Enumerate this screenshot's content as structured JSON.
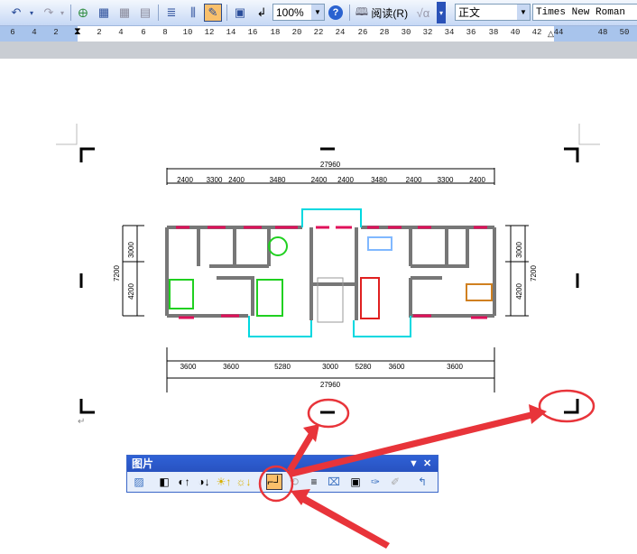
{
  "toolbar": {
    "zoom": "100%",
    "read_label": "阅读(R)",
    "style": "正文",
    "font": "Times New Roman"
  },
  "ruler": {
    "ticks": [
      "6",
      "4",
      "2",
      "2",
      "4",
      "6",
      "8",
      "10",
      "12",
      "14",
      "16",
      "18",
      "20",
      "22",
      "24",
      "26",
      "28",
      "30",
      "32",
      "34",
      "36",
      "38",
      "40",
      "42",
      "44",
      "48",
      "50"
    ]
  },
  "drawing": {
    "top_total": "27960",
    "top_dims": [
      "2400",
      "3300",
      "2400",
      "3480",
      "2400",
      "2400",
      "3480",
      "2400",
      "3300",
      "2400"
    ],
    "bottom_dims": [
      "3600",
      "3600",
      "5280",
      "3000",
      "5280",
      "3600",
      "3600"
    ],
    "bottom_total": "27960",
    "left_dims": [
      "3000",
      "4200"
    ],
    "left_total": "7200",
    "right_dims": [
      "3000",
      "4200"
    ],
    "right_total": "7200"
  },
  "picture_toolbar": {
    "title": "图片",
    "menu_icon": "▼",
    "close_icon": "✕",
    "active_tool": "crop"
  },
  "annotation_color": "#e8343a",
  "paragraph_mark": "↵"
}
